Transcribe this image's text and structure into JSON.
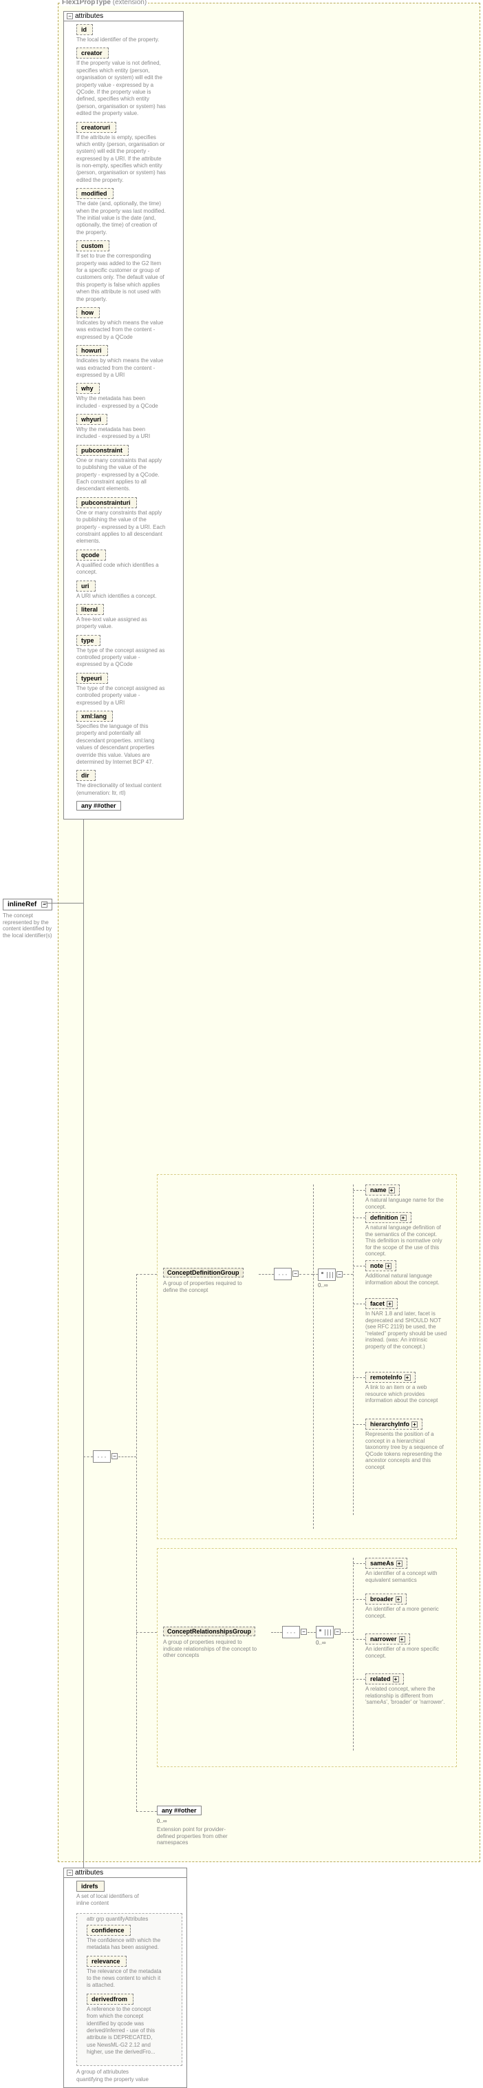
{
  "header": {
    "type": "Flex1PropType",
    "ext": "(extension)"
  },
  "root": {
    "name": "inlineRef",
    "desc": "The concept represented by the content identified by the local identifier(s)"
  },
  "attrs_title": "attributes",
  "attributes": [
    {
      "name": "id",
      "desc": "The local identifier of the property."
    },
    {
      "name": "creator",
      "desc": "If the property value is not defined, specifies which entity (person, organisation or system) will edit the property value - expressed by a QCode. If the property value is defined, specifies which entity (person, organisation or system) has edited the property value."
    },
    {
      "name": "creatoruri",
      "desc": "If the attribute is empty, specifies which entity (person, organisation or system) will edit the property - expressed by a URI. If the attribute is non-empty, specifies which entity (person, organisation or system) has edited the property."
    },
    {
      "name": "modified",
      "desc": "The date (and, optionally, the time) when the property was last modified. The initial value is the date (and, optionally, the time) of creation of the property."
    },
    {
      "name": "custom",
      "desc": "If set to true the corresponding property was added to the G2 Item for a specific customer or group of customers only. The default value of this property is false which applies when this attribute is not used with the property."
    },
    {
      "name": "how",
      "desc": "Indicates by which means the value was extracted from the content - expressed by a QCode"
    },
    {
      "name": "howuri",
      "desc": "Indicates by which means the value was extracted from the content - expressed by a URI"
    },
    {
      "name": "why",
      "desc": "Why the metadata has been included - expressed by a QCode"
    },
    {
      "name": "whyuri",
      "desc": "Why the metadata has been included - expressed by a URI"
    },
    {
      "name": "pubconstraint",
      "desc": "One or many constraints that apply to publishing the value of the property - expressed by a QCode. Each constraint applies to all descendant elements."
    },
    {
      "name": "pubconstrainturi",
      "desc": "One or many constraints that apply to publishing the value of the property - expressed by a URI. Each constraint applies to all descendant elements."
    },
    {
      "name": "qcode",
      "desc": "A qualified code which identifies a concept."
    },
    {
      "name": "uri",
      "desc": "A URI which identifies a concept."
    },
    {
      "name": "literal",
      "desc": "A free-text value assigned as property value."
    },
    {
      "name": "type",
      "desc": "The type of the concept assigned as controlled property value - expressed by a QCode"
    },
    {
      "name": "typeuri",
      "desc": "The type of the concept assigned as controlled property value - expressed by a URI"
    },
    {
      "name": "xml:lang",
      "desc": "Specifies the language of this property and potentially all descendant properties. xml:lang values of descendant properties override this value. Values are determined by Internet BCP 47."
    },
    {
      "name": "dir",
      "desc": "The directionality of textual content (enumeration: ltr, rtl)"
    }
  ],
  "any_other": "any ##other",
  "seq_occur": "0..∞",
  "groups": {
    "def": {
      "label": "ConceptDefinitionGroup",
      "desc": "A group of properties required to define the concept"
    },
    "rel": {
      "label": "ConceptRelationshipsGroup",
      "desc": "A group of properties required to indicate relationships of the concept to other concepts"
    }
  },
  "children_def": [
    {
      "name": "name",
      "desc": "A natural language name for the concept."
    },
    {
      "name": "definition",
      "desc": "A natural language definition of the semantics of the concept. This definition is normative only for the scope of the use of this concept."
    },
    {
      "name": "note",
      "desc": "Additional natural language information about the concept."
    },
    {
      "name": "facet",
      "desc": "In NAR 1.8 and later, facet is deprecated and SHOULD NOT (see RFC 2119) be used, the \"related\" property should be used instead. (was: An intrinsic property of the concept.)"
    },
    {
      "name": "remoteInfo",
      "desc": "A link to an item or a web resource which provides information about the concept"
    },
    {
      "name": "hierarchyInfo",
      "desc": "Represents the position of a concept in a hierarchical taxonomy tree by a sequence of QCode tokens representing the ancestor concepts and this concept"
    }
  ],
  "children_rel": [
    {
      "name": "sameAs",
      "desc": "An identifier of a concept with equivalent semantics"
    },
    {
      "name": "broader",
      "desc": "An identifier of a more generic concept."
    },
    {
      "name": "narrower",
      "desc": "An identifier of a more specific concept."
    },
    {
      "name": "related",
      "desc": "A related concept, where the relationship is different from 'sameAs', 'broader' or 'narrower'."
    }
  ],
  "ext_any": {
    "label": "any ##other",
    "desc": "Extension point for provider-defined properties from other namespaces"
  },
  "attrs2": {
    "title": "attributes",
    "idrefs": {
      "name": "idrefs",
      "desc": "A set of local identifiers of inline content",
      "req": true
    },
    "group_label": "attr grp quantifyAttributes",
    "items": [
      {
        "name": "confidence",
        "desc": "The confidence with which the metadata has been assigned."
      },
      {
        "name": "relevance",
        "desc": "The relevance of the metadata to the news content to which it is attached."
      },
      {
        "name": "derivedfrom",
        "desc": "A reference to the concept from which the concept identified by qcode was derived/inferred - use of this attribute is DEPRECATED, use NewsML-G2 2.12 and higher, use the derivedFro..."
      }
    ],
    "group_desc": "A group of attriubutes quantifying the property value"
  }
}
